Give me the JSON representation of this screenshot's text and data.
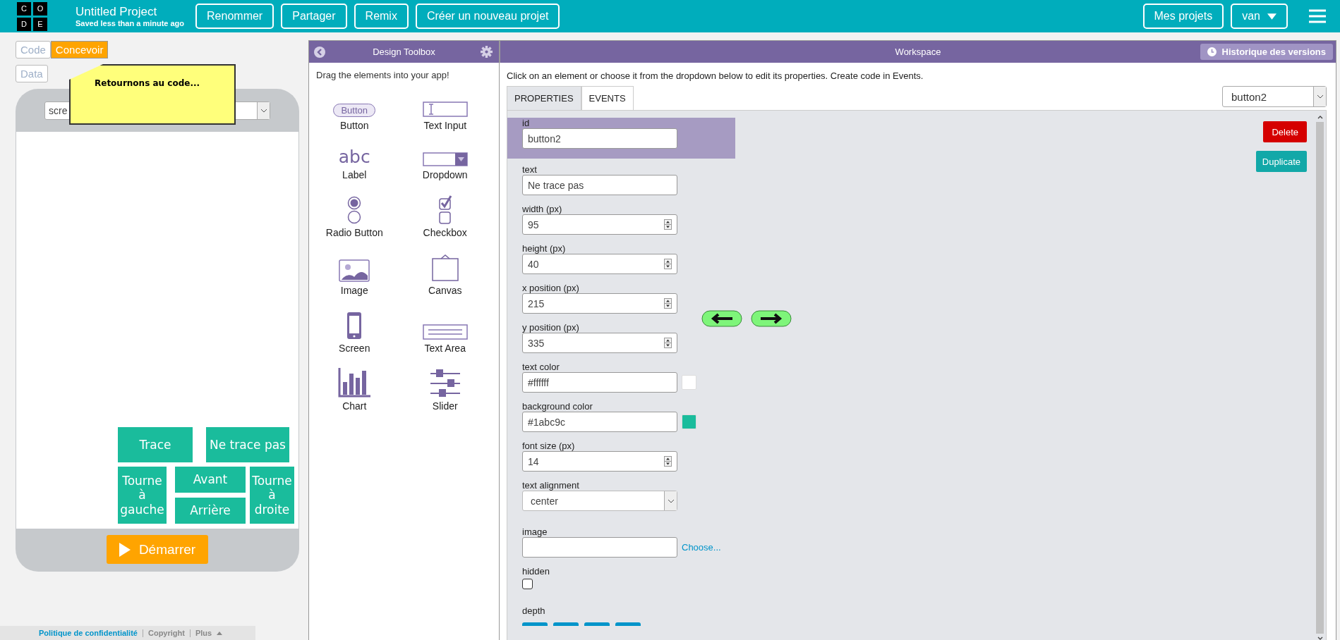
{
  "header": {
    "logo_letters": [
      "C",
      "O",
      "D",
      "E"
    ],
    "project_title": "Untitled Project",
    "saved_status": "Saved less than a minute ago",
    "buttons": [
      "Renommer",
      "Partager",
      "Remix",
      "Créer un nouveau projet"
    ],
    "my_projects": "Mes projets",
    "user": "van"
  },
  "left_panel": {
    "mode_tabs": [
      {
        "label": "Code",
        "selected": false
      },
      {
        "label": "Concevoir",
        "selected": true
      }
    ],
    "data_button": "Data",
    "tooltip": "Retournons au code...",
    "screen_dropdown": "scre",
    "app_buttons": [
      "Trace",
      "Ne trace pas",
      "Tourne à gauche",
      "Avant",
      "Arrière",
      "Tourne à droite"
    ],
    "run_button": "Démarrer",
    "footer": {
      "links": [
        "Politique de confidentialité",
        "Copyright",
        "Plus"
      ]
    }
  },
  "toolbox": {
    "title": "Design Toolbox",
    "hint": "Drag the elements into your app!",
    "button_icon_text": "Button",
    "label_icon_text": "abc",
    "items": [
      {
        "label": "Button",
        "kind": "button"
      },
      {
        "label": "Text Input",
        "kind": "textinput"
      },
      {
        "label": "Label",
        "kind": "label"
      },
      {
        "label": "Dropdown",
        "kind": "dropdown"
      },
      {
        "label": "Radio Button",
        "kind": "radio"
      },
      {
        "label": "Checkbox",
        "kind": "checkbox"
      },
      {
        "label": "Image",
        "kind": "image"
      },
      {
        "label": "Canvas",
        "kind": "canvas"
      },
      {
        "label": "Screen",
        "kind": "screen"
      },
      {
        "label": "Text Area",
        "kind": "textarea"
      },
      {
        "label": "Chart",
        "kind": "chart"
      },
      {
        "label": "Slider",
        "kind": "slider"
      }
    ]
  },
  "workspace": {
    "title": "Workspace",
    "history_button": "Historique des versions",
    "instructions": "Click on an element or choose it from the dropdown below to edit its properties. Create code in Events.",
    "tabs": [
      {
        "label": "PROPERTIES",
        "selected": true
      },
      {
        "label": "EVENTS",
        "selected": false
      }
    ],
    "element_dropdown": "button2",
    "properties": [
      {
        "label": "id",
        "kind": "text",
        "value": "button2",
        "selected": true
      },
      {
        "label": "text",
        "kind": "text",
        "value": "Ne trace pas",
        "selected": false
      },
      {
        "label": "width (px)",
        "kind": "number",
        "value": "95",
        "selected": false
      },
      {
        "label": "height (px)",
        "kind": "number",
        "value": "40",
        "selected": false
      },
      {
        "label": "x position (px)",
        "kind": "number",
        "value": "215",
        "selected": false
      },
      {
        "label": "y position (px)",
        "kind": "number",
        "value": "335",
        "selected": false
      },
      {
        "label": "text color",
        "kind": "color",
        "value": "#ffffff",
        "selected": false
      },
      {
        "label": "background color",
        "kind": "color",
        "value": "#1abc9c",
        "selected": false
      },
      {
        "label": "font size (px)",
        "kind": "number",
        "value": "14",
        "selected": false
      },
      {
        "label": "text alignment",
        "kind": "select",
        "value": "center",
        "selected": false
      },
      {
        "label": "image",
        "kind": "image",
        "link": "Choose...",
        "selected": false
      },
      {
        "label": "hidden",
        "kind": "checkbox",
        "checked": false,
        "selected": false
      },
      {
        "label": "depth",
        "kind": "depth",
        "selected": false
      }
    ],
    "delete_button": "Delete",
    "duplicate_button": "Duplicate"
  }
}
